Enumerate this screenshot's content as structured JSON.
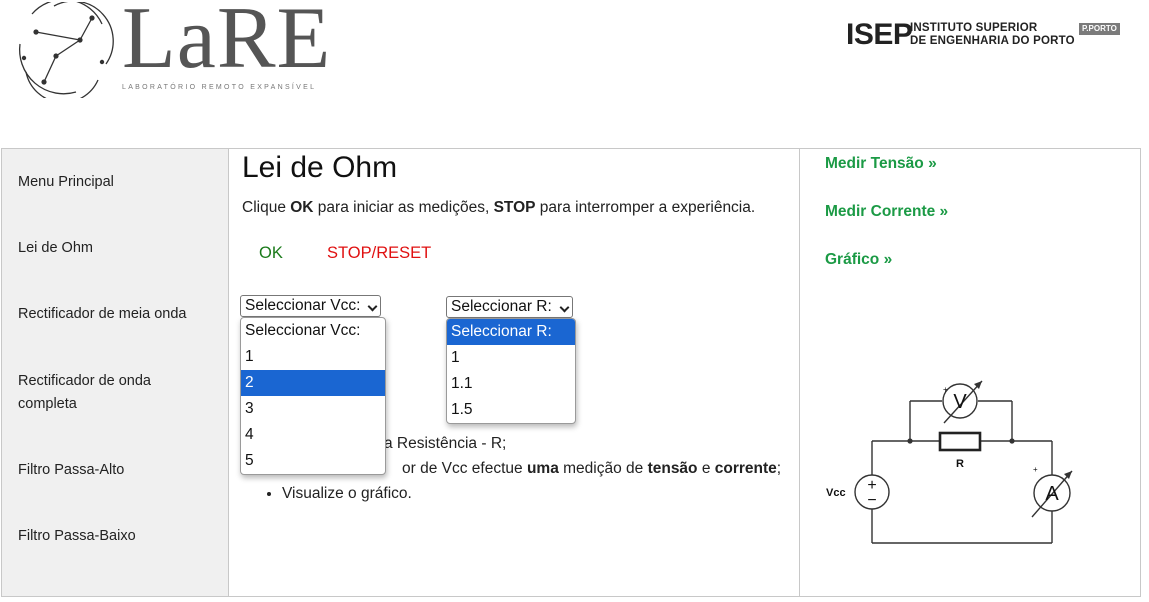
{
  "header": {
    "logo_text": "LaRE",
    "logo_subtitle": "LABORATÓRIO REMOTO EXPANSÍVEL",
    "isep_mark": "ISEP",
    "isep_line1": "INSTITUTO SUPERIOR",
    "isep_line2": "DE ENGENHARIA DO PORTO",
    "pporto": "P.PORTO"
  },
  "sidebar": {
    "items": [
      {
        "label": "Menu Principal"
      },
      {
        "label": "Lei de Ohm"
      },
      {
        "label": "Rectificador de meia onda"
      },
      {
        "label": "Rectificador de onda completa"
      },
      {
        "label": "Filtro Passa-Alto"
      },
      {
        "label": "Filtro Passa-Baixo"
      }
    ]
  },
  "main": {
    "title": "Lei de Ohm",
    "instructions": {
      "p1": "Clique ",
      "ok": "OK",
      "p2": " para iniciar as medições, ",
      "stop": "STOP",
      "p3": " para interromper a experiência."
    },
    "ok_label": "OK",
    "stop_label": "STOP/RESET",
    "vcc_select": {
      "selected": "Seleccionar Vcc:",
      "options": [
        "Seleccionar Vcc:",
        "1",
        "2",
        "3",
        "4",
        "5"
      ],
      "highlighted": "2"
    },
    "r_select": {
      "selected": "Seleccionar R:",
      "options": [
        "Seleccionar R:",
        "1",
        "1.1",
        "1.5"
      ],
      "highlighted": "Seleccionar R:"
    },
    "steps": {
      "s1": "a Resistência - R;",
      "s2a": "or de Vcc efectue ",
      "s2b": "uma",
      "s2c": " medição de ",
      "s2d": "tensão",
      "s2e": " e ",
      "s2f": "corrente",
      "s2g": ";",
      "s3": "Visualize o gráfico."
    }
  },
  "right": {
    "links": [
      {
        "label": "Medir Tensão »"
      },
      {
        "label": "Medir Corrente »"
      },
      {
        "label": "Gráfico »"
      }
    ],
    "circuit": {
      "voltmeter": "V",
      "ammeter": "A",
      "resistor": "R",
      "source": "Vcc",
      "plus": "+",
      "minus": "−"
    }
  },
  "colors": {
    "ok": "#1a7a1a",
    "stop": "#e01010",
    "link": "#1b9a45",
    "highlight": "#1a66d2"
  }
}
